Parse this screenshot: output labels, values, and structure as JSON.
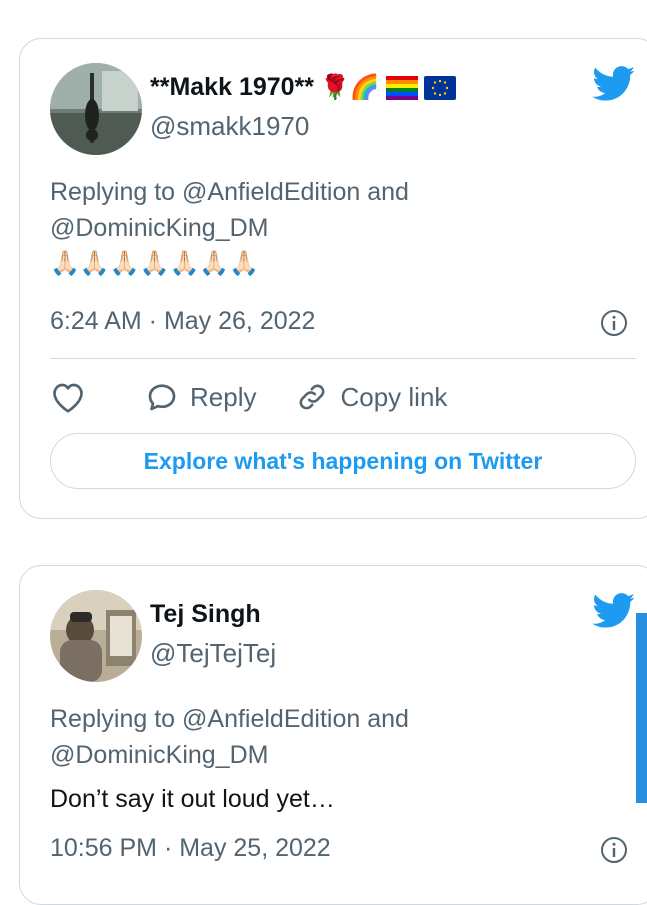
{
  "tweets": [
    {
      "display_name": "**Makk 1970**",
      "name_emojis": "🌹🌈",
      "handle": "@smakk1970",
      "reply_line1": "Replying to @AnfieldEdition and",
      "reply_line2": "@DominicKing_DM",
      "text": "🙏🏻🙏🏻🙏🏻🙏🏻🙏🏻🙏🏻🙏🏻",
      "timestamp": "6:24 AM · May 26, 2022",
      "actions": {
        "reply_label": "Reply",
        "copy_label": "Copy link"
      },
      "explore_label": "Explore what's happening on Twitter"
    },
    {
      "display_name": "Tej Singh",
      "handle": "@TejTejTej",
      "reply_line1": "Replying to @AnfieldEdition and",
      "reply_line2": "@DominicKing_DM",
      "text": "Don’t say it out loud yet…",
      "timestamp": "10:56 PM · May 25, 2022"
    }
  ],
  "colors": {
    "twitter_blue": "#1d9bf0",
    "secondary_text": "#536471",
    "border": "#cfd9de",
    "side_bar": "#2a8ee0"
  },
  "icons": [
    "twitter-bird-icon",
    "info-icon",
    "heart-icon",
    "reply-bubble-icon",
    "link-icon"
  ]
}
